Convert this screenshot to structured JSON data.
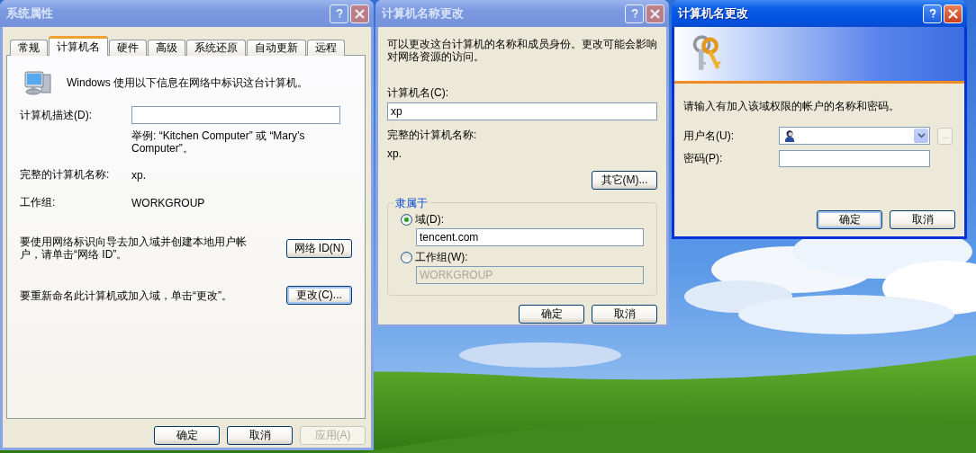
{
  "system_properties": {
    "title": "系统属性",
    "active": false,
    "tabs": [
      {
        "label": "常规",
        "selected": false
      },
      {
        "label": "计算机名",
        "selected": true
      },
      {
        "label": "硬件",
        "selected": false
      },
      {
        "label": "高级",
        "selected": false
      },
      {
        "label": "系统还原",
        "selected": false
      },
      {
        "label": "自动更新",
        "selected": false
      },
      {
        "label": "远程",
        "selected": false
      }
    ],
    "intro": "Windows 使用以下信息在网络中标识这台计算机。",
    "description_label": "计算机描述(D):",
    "example": "举例: “Kitchen Computer” 或 “Mary’s Computer”。",
    "full_name": {
      "label": "完整的计算机名称:",
      "value": "xp."
    },
    "workgroup": {
      "label": "工作组:",
      "value": "WORKGROUP"
    },
    "network_id": {
      "text": "要使用网络标识向导去加入域并创建本地用户帐户，请单击“网络 ID”。",
      "button": {
        "label": "网络 ID(N)",
        "disabled": false,
        "focused": false
      }
    },
    "rename": {
      "text": "要重新命名此计算机或加入域，单击“更改”。",
      "button": {
        "label": "更改(C)...",
        "disabled": false,
        "focused": true
      }
    },
    "buttons": [
      {
        "label": "确定",
        "disabled": false,
        "focused": false
      },
      {
        "label": "取消",
        "disabled": false,
        "focused": false
      },
      {
        "label": "应用(A)",
        "disabled": true,
        "focused": false
      }
    ]
  },
  "name_change": {
    "title": "计算机名称更改",
    "active": false,
    "intro": "可以更改这台计算机的名称和成员身份。更改可能会影响对网络资源的访问。",
    "computer_name": {
      "label": "计算机名(C):",
      "value": "xp"
    },
    "full_name": {
      "label": "完整的计算机名称:",
      "value": "xp."
    },
    "more_button": {
      "label": "其它(M)...",
      "disabled": false,
      "focused": false
    },
    "member_of": {
      "legend": "隶属于",
      "options": [
        {
          "label": "域(D):",
          "selected": true,
          "value": "tencent.com",
          "disabled": false
        },
        {
          "label": "工作组(W):",
          "selected": false,
          "value": "WORKGROUP",
          "disabled": true
        }
      ]
    },
    "buttons": [
      {
        "label": "确定",
        "disabled": false,
        "focused": false
      },
      {
        "label": "取消",
        "disabled": false,
        "focused": false
      }
    ]
  },
  "credentials": {
    "title": "计算机名更改",
    "active": true,
    "intro": "请输入有加入该域权限的帐户的名称和密码。",
    "username_label": "用户名(U):",
    "password_label": "密码(P):",
    "browse_button": {
      "label": "...",
      "disabled": true,
      "focused": false
    },
    "buttons": [
      {
        "label": "确定",
        "disabled": false,
        "focused": true
      },
      {
        "label": "取消",
        "disabled": false,
        "focused": false
      }
    ]
  }
}
